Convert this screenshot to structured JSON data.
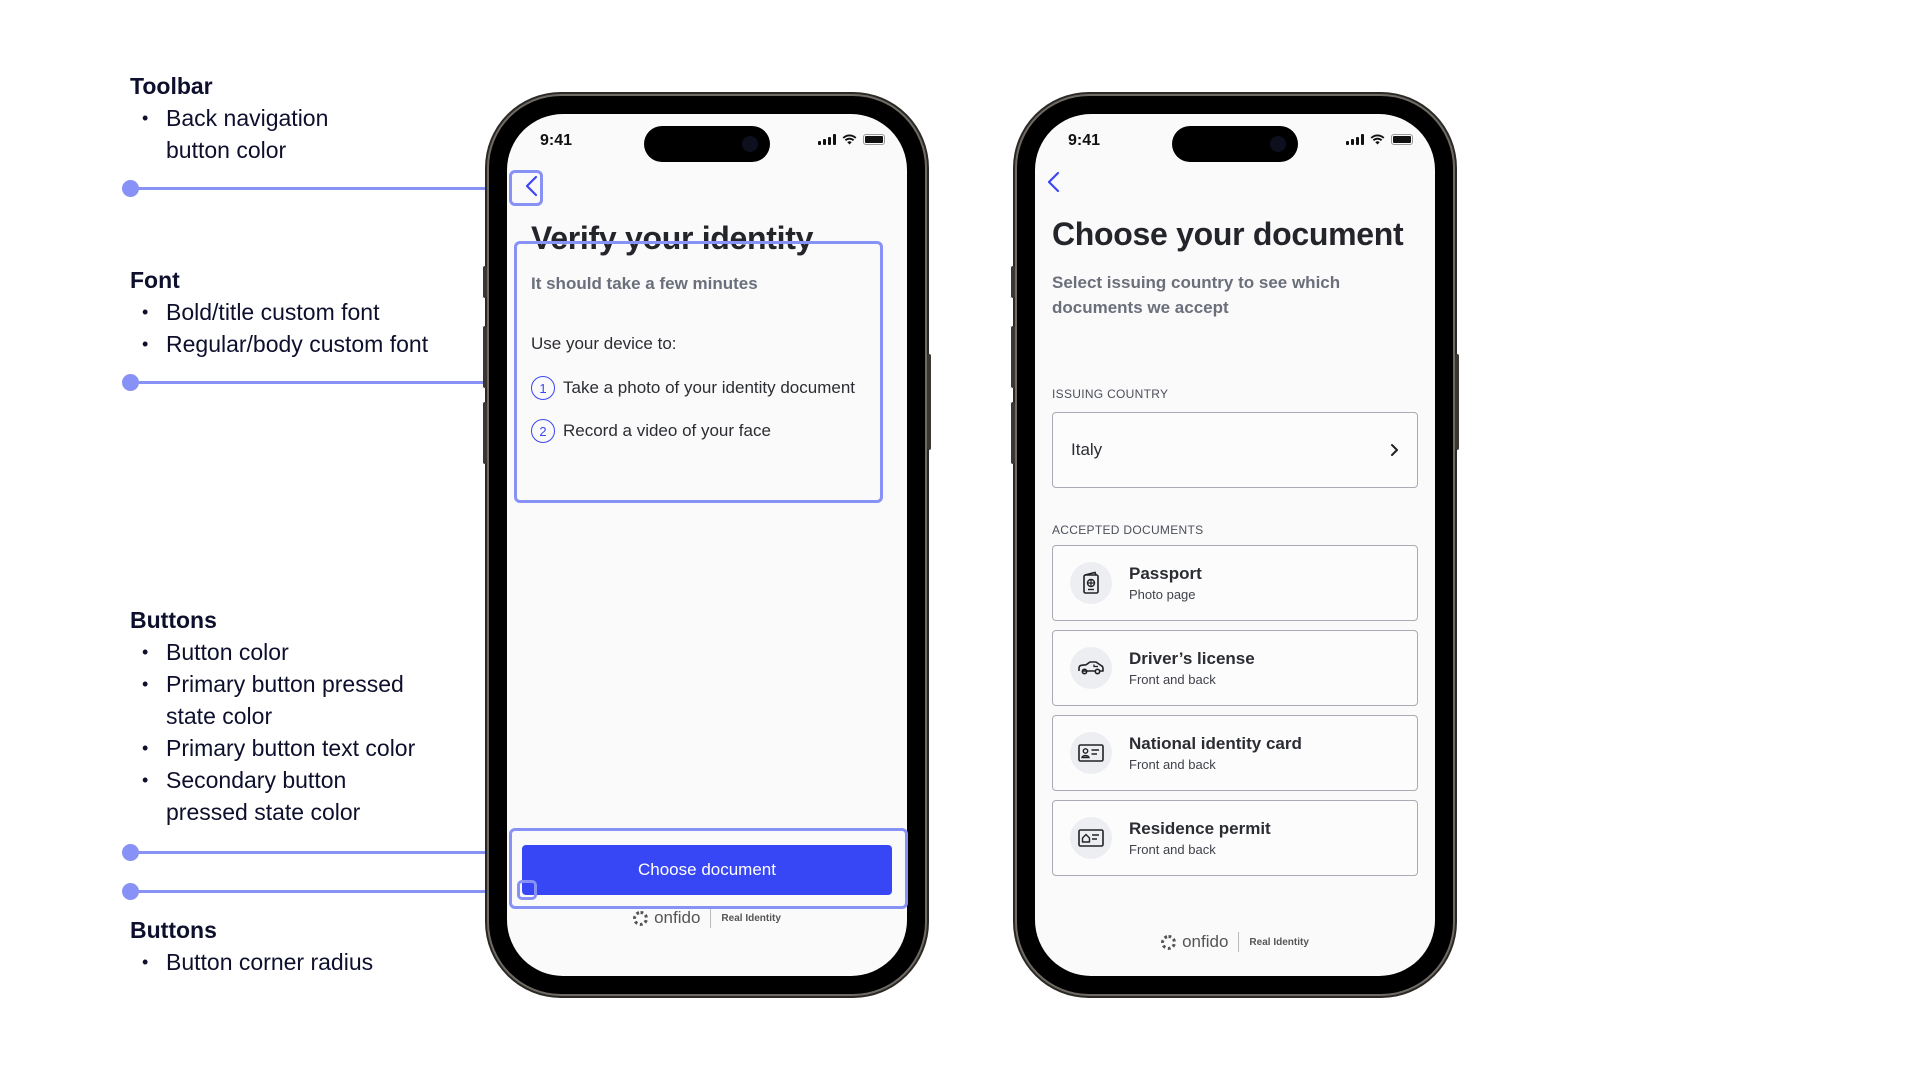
{
  "annotations": {
    "toolbar": {
      "heading": "Toolbar",
      "items": [
        "Back navigation button color"
      ]
    },
    "font": {
      "heading": "Font",
      "items": [
        "Bold/title custom font",
        "Regular/body custom font"
      ]
    },
    "buttons": {
      "heading": "Buttons",
      "items": [
        "Button color",
        "Primary button pressed state color",
        "Primary button text color",
        "Secondary button pressed state color"
      ]
    },
    "radius": {
      "heading": "Buttons",
      "items": [
        "Button corner radius"
      ]
    },
    "accent_color": "#8891f5"
  },
  "phone1": {
    "status_time": "9:41",
    "title": "Verify your identity",
    "subtitle": "It should take a few minutes",
    "intro": "Use your device to:",
    "steps": [
      {
        "num": "1",
        "text": "Take a photo of your identity document"
      },
      {
        "num": "2",
        "text": "Record a video of your face"
      }
    ],
    "primary_button": "Choose document",
    "footer": {
      "brand": "onfido",
      "tagline": "Real Identity"
    }
  },
  "phone2": {
    "status_time": "9:41",
    "title": "Choose your document",
    "subtitle": "Select issuing country to see which documents we accept",
    "country_label": "ISSUING COUNTRY",
    "country_value": "Italy",
    "docs_label": "ACCEPTED DOCUMENTS",
    "documents": [
      {
        "title": "Passport",
        "subtitle": "Photo page",
        "icon": "passport-icon"
      },
      {
        "title": "Driver’s license",
        "subtitle": "Front and back",
        "icon": "car-icon"
      },
      {
        "title": "National identity card",
        "subtitle": "Front and back",
        "icon": "id-card-icon"
      },
      {
        "title": "Residence permit",
        "subtitle": "Front and back",
        "icon": "residence-permit-icon"
      }
    ],
    "footer": {
      "brand": "onfido",
      "tagline": "Real Identity"
    }
  },
  "colors": {
    "primary": "#3847f5",
    "back_icon": "#3c46f0"
  }
}
